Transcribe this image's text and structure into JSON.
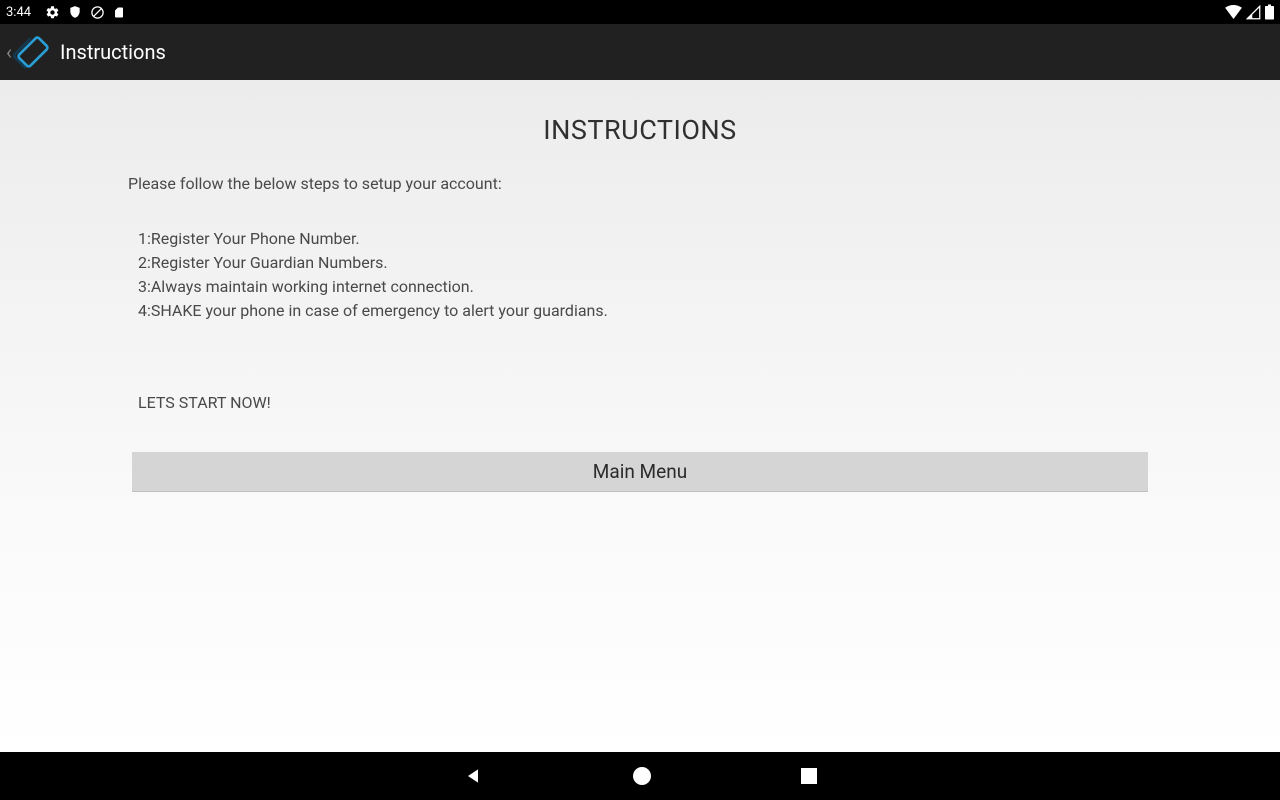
{
  "status_bar": {
    "time": "3:44",
    "icons_left": [
      "gear-icon",
      "shield-icon",
      "no-circle-icon",
      "sd-card-icon"
    ],
    "icons_right": [
      "wifi-icon",
      "cell-signal-icon",
      "battery-icon"
    ]
  },
  "action_bar": {
    "title": "Instructions"
  },
  "page": {
    "heading": "INSTRUCTIONS",
    "intro": "Please follow the below steps to setup your account:",
    "steps": {
      "s1": "1:Register Your Phone Number.",
      "s2": "2:Register Your Guardian Numbers.",
      "s3": "3:Always maintain working internet connection.",
      "s4": "4:SHAKE your phone in case of emergency to alert your guardians."
    },
    "start_now": "LETS START NOW!",
    "main_menu_label": "Main Menu"
  },
  "nav_bar": {
    "buttons": [
      "back",
      "home",
      "recents"
    ]
  }
}
